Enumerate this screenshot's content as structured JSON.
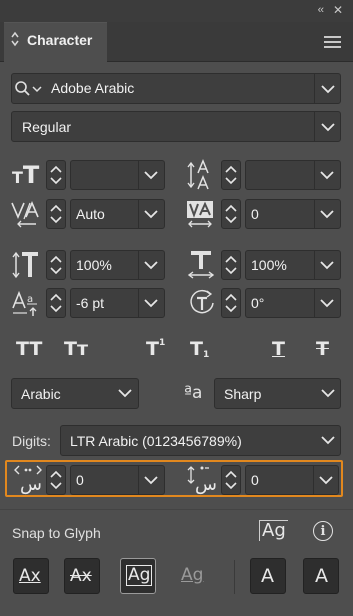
{
  "panel": {
    "title": "Character"
  },
  "font": {
    "family": "Adobe Arabic",
    "style": "Regular"
  },
  "size": {
    "font_size": "",
    "leading": ""
  },
  "kerning": {
    "value": "Auto"
  },
  "tracking": {
    "value": "0"
  },
  "scale": {
    "vertical": "100%",
    "horizontal": "100%"
  },
  "baseline": {
    "shift": "-6 pt"
  },
  "rotation": {
    "value": "0°"
  },
  "styles": {
    "all_caps": "TT",
    "small_caps": "Tт",
    "superscript": "T",
    "superscript_mark": "1",
    "subscript": "T",
    "subscript_mark": "1",
    "underline": "T",
    "strikethrough": "T"
  },
  "language": {
    "value": "Arabic"
  },
  "antialias": {
    "icon_text": "ªa",
    "value": "Sharp"
  },
  "digits": {
    "label": "Digits:",
    "value": "LTR Arabic (0123456789%)"
  },
  "arabic": {
    "kashida_width": "0",
    "diacritic_position": "0",
    "glyph_text": "س"
  },
  "snap": {
    "label": "Snap to Glyph",
    "buttons": {
      "ax1": "Ax",
      "ax2": "Ax",
      "ag_sel": "Ag",
      "ag_under": "Ag",
      "a_right": "A",
      "a_left": "A"
    },
    "proximity_glyph": "Ag",
    "info_glyph": "i"
  },
  "colors": {
    "highlight": "#e2881e"
  }
}
